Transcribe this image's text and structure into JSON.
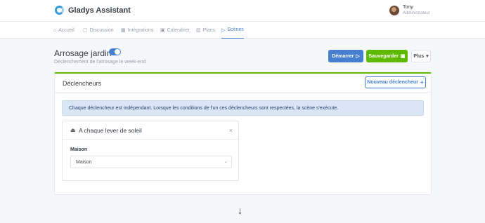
{
  "header": {
    "brand": "Gladys Assistant",
    "user_name": "Tony",
    "user_role": "Administrateur"
  },
  "nav": {
    "items": [
      {
        "label": "Accueil",
        "icon": "home-icon"
      },
      {
        "label": "Discussion",
        "icon": "chat-icon"
      },
      {
        "label": "Intégrations",
        "icon": "grid-icon"
      },
      {
        "label": "Calendrier",
        "icon": "calendar-icon"
      },
      {
        "label": "Plans",
        "icon": "map-icon"
      },
      {
        "label": "Scènes",
        "icon": "play-icon",
        "active": true
      }
    ]
  },
  "scene": {
    "title": "Arrosage jardin",
    "description": "Déclenchement de l'arrosage le week-end",
    "active": true,
    "start_label": "Démarrer",
    "save_label": "Sauvegarder",
    "more_label": "Plus"
  },
  "triggers_card": {
    "title": "Déclencheurs",
    "new_trigger_label": "Nouveau déclencheur",
    "info": "Chaque déclencheur est indépendant. Lorsque les conditions de l'un ces déclencheurs sont respectées, la scène s'exécute.",
    "trigger": {
      "title": "A chaque lever de soleil",
      "icon": "sunrise-icon",
      "field_label": "Maison",
      "select_value": "Maison"
    }
  },
  "colors": {
    "primary": "#467fcf",
    "success": "#5eba00",
    "background": "#f5f7fb"
  }
}
